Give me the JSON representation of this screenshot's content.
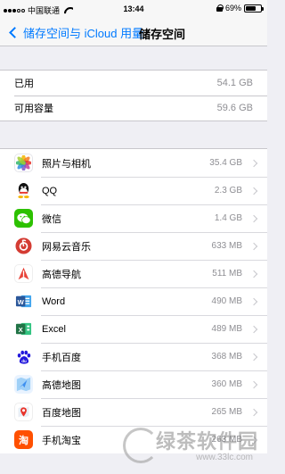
{
  "status_bar": {
    "carrier": "中国联通",
    "time": "13:44",
    "battery": "69%",
    "battery_level": 0.69
  },
  "nav": {
    "back_label": "储存空间与 iCloud 用量",
    "title": "储存空间"
  },
  "summary": [
    {
      "label": "已用",
      "value": "54.1 GB"
    },
    {
      "label": "可用容量",
      "value": "59.6 GB"
    }
  ],
  "apps": [
    {
      "name": "照片与相机",
      "size": "35.4 GB",
      "icon": "photos-icon",
      "color": "#ffffff"
    },
    {
      "name": "QQ",
      "size": "2.3 GB",
      "icon": "qq-icon",
      "color": "#ffffff"
    },
    {
      "name": "微信",
      "size": "1.4 GB",
      "icon": "wechat-icon",
      "color": "#2dc100"
    },
    {
      "name": "网易云音乐",
      "size": "633 MB",
      "icon": "netease-music-icon",
      "color": "#d43c33"
    },
    {
      "name": "高德导航",
      "size": "511 MB",
      "icon": "amap-navi-icon",
      "color": "#e8443a"
    },
    {
      "name": "Word",
      "size": "490 MB",
      "icon": "word-icon",
      "color": "#2b579a"
    },
    {
      "name": "Excel",
      "size": "489 MB",
      "icon": "excel-icon",
      "color": "#217346"
    },
    {
      "name": "手机百度",
      "size": "368 MB",
      "icon": "baidu-icon",
      "color": "#ffffff"
    },
    {
      "name": "高德地图",
      "size": "360 MB",
      "icon": "amap-icon",
      "color": "#3d8ff0"
    },
    {
      "name": "百度地图",
      "size": "265 MB",
      "icon": "baidu-map-icon",
      "color": "#ffffff"
    },
    {
      "name": "手机淘宝",
      "size": "263 MB",
      "icon": "taobao-icon",
      "color": "#ff5000"
    }
  ],
  "watermark": {
    "text": "绿茶软件园",
    "url": "www.33lc.com"
  }
}
